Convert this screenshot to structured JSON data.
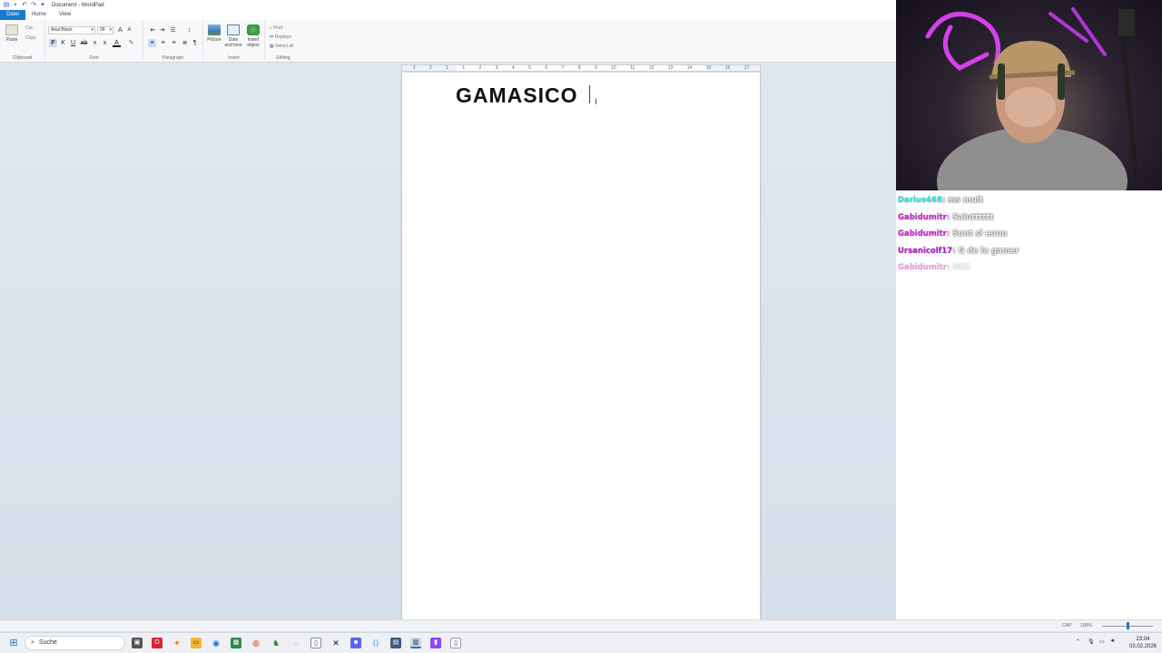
{
  "window": {
    "title": "Document - WordPad"
  },
  "quick_access": [
    "save-icon",
    "undo-icon",
    "redo-icon",
    "customize-icon"
  ],
  "ribbon": {
    "tabs": [
      {
        "label": "Datei",
        "active": true
      },
      {
        "label": "Home"
      },
      {
        "label": "View"
      }
    ],
    "clipboard": {
      "paste_label": "Paste",
      "cut_label": "Cut",
      "copy_label": "Copy",
      "group_label": "Clipboard"
    },
    "font": {
      "family": "Arial Black",
      "size": "36",
      "group_label": "Font"
    },
    "paragraph": {
      "group_label": "Paragraph"
    },
    "insert": {
      "picture_label": "Picture",
      "datetime_label": "Date and time",
      "object_label": "Insert object",
      "group_label": "Insert"
    },
    "editing": {
      "find_label": "Find",
      "replace_label": "Replace",
      "selectall_label": "Select all",
      "group_label": "Editing"
    }
  },
  "ruler": {
    "ticks": [
      "3",
      "2",
      "1",
      "1",
      "2",
      "3",
      "4",
      "5",
      "6",
      "7",
      "8",
      "9",
      "10",
      "11",
      "12",
      "13",
      "14",
      "15",
      "16",
      "17"
    ]
  },
  "document": {
    "text": "GAMASICO"
  },
  "chat": [
    {
      "user": "Darius468",
      "color": "#2fe0e0",
      "message": "ms mult"
    },
    {
      "user": "Gabidumitr",
      "color": "#d426d4",
      "message": "Salutttttt"
    },
    {
      "user": "Gabidumitr",
      "color": "#d426d4",
      "message": "Sunt si euuu"
    },
    {
      "user": "Ursanicolf17",
      "color": "#b520d0",
      "message": "G de la gamer"
    },
    {
      "user": "Gabidumitr",
      "color": "#d426d4",
      "message": "!!!!!",
      "faded": true
    }
  ],
  "statusbar": {
    "cap": "CAP",
    "zoom": "100%",
    "zoom_level": 1.0
  },
  "taskbar": {
    "search_label": "Suche"
  },
  "clock": {
    "time": "23:04",
    "date": "03.02.2026"
  }
}
